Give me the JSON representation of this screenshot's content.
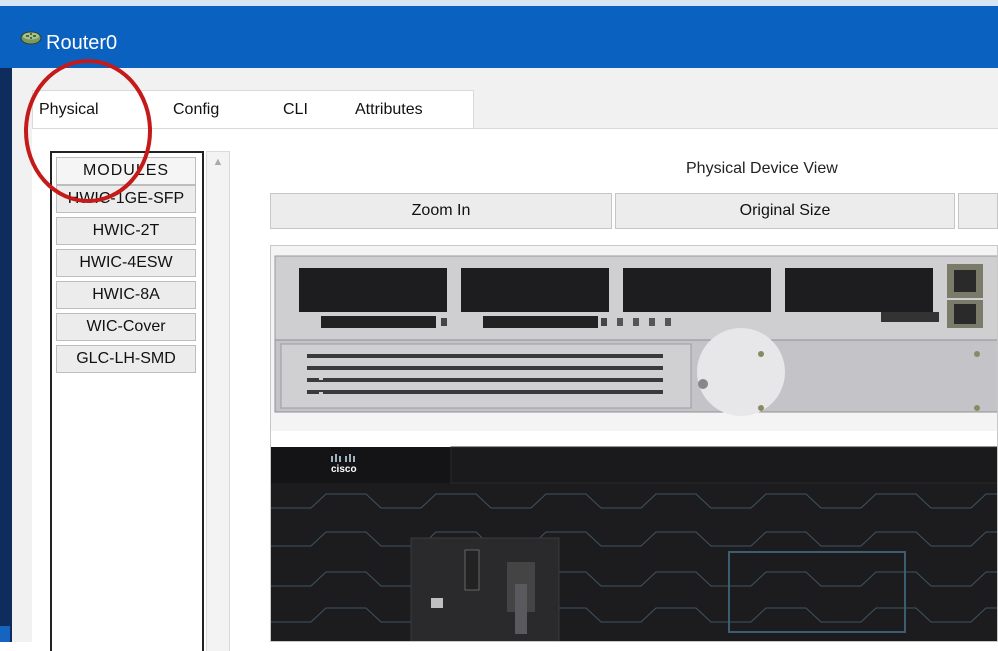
{
  "window": {
    "title": "Router0"
  },
  "tabs": [
    {
      "label": "Physical",
      "active": true
    },
    {
      "label": "Config"
    },
    {
      "label": "CLI"
    },
    {
      "label": "Attributes"
    }
  ],
  "modules": {
    "header": "MODULES",
    "items": [
      "HWIC-1GE-SFP",
      "HWIC-2T",
      "HWIC-4ESW",
      "HWIC-8A",
      "WIC-Cover",
      "GLC-LH-SMD"
    ]
  },
  "physical_view": {
    "title": "Physical Device View",
    "zoom_in_label": "Zoom In",
    "original_size_label": "Original Size"
  },
  "device": {
    "brand": "cisco"
  },
  "colors": {
    "titlebar": "#0b61c0",
    "annotation_circle": "#c41a1a",
    "chassis_dark": "#1c1c1e"
  }
}
